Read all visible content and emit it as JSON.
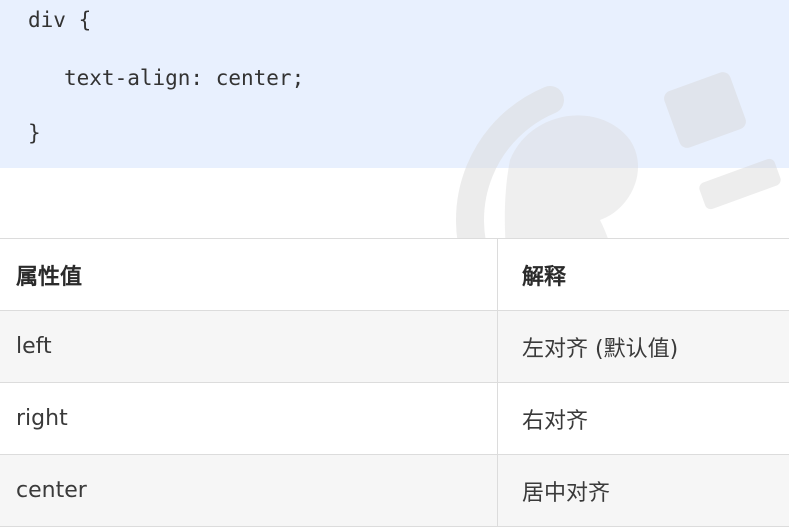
{
  "code": {
    "line1": "div {",
    "line2": "text-align: center;",
    "line3": "}"
  },
  "table": {
    "headers": [
      "属性值",
      "解释"
    ],
    "rows": [
      [
        "left",
        "左对齐 (默认值)"
      ],
      [
        "right",
        "右对齐"
      ],
      [
        "center",
        "居中对齐"
      ]
    ]
  },
  "colors": {
    "code_background": "#e8f0fe",
    "row_alt_background": "#f6f6f6",
    "border": "#dcdcdc",
    "text": "#333333"
  },
  "icons": {
    "watermark": "logo-watermark-icon"
  }
}
